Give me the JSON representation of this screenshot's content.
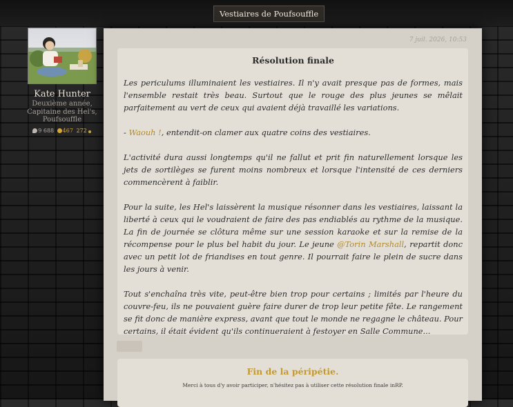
{
  "header": {
    "title": "Vestiaires de Poufsouffle"
  },
  "author": {
    "name": "Kate Hunter",
    "role_lines": [
      "Deuxième année,",
      "Capitaine des Hel's,",
      "Poufsouffle"
    ],
    "stats": {
      "messages": "9 688",
      "coins": "467",
      "points": "272"
    }
  },
  "post": {
    "date": "7 juil. 2026, 10:53",
    "title": "Résolution finale",
    "p1": "Les periculums illuminaient les vestiaires. Il n'y avait presque pas de formes, mais l'ensemble restait très beau. Surtout que le rouge des plus jeunes se mêlait parfaitement au vert de ceux qui avaient déjà travaillé les variations.",
    "p2_dash": "- ",
    "p2_quote": "Waouh !",
    "p2_rest": ", entendit-on clamer aux quatre coins des vestiaires.",
    "p3": "L'activité dura aussi longtemps qu'il ne fallut et prit fin naturellement lorsque les jets de sortilèges se furent moins nombreux et lorsque l'intensité de ces derniers commencèrent à faiblir.",
    "p4_before": "Pour la suite, les Hel's laissèrent la musique résonner dans les vestiaires, laissant la liberté à ceux qui le voudraient de faire des pas endiablés au rythme de la musique. La fin de journée se clôtura même sur une session karaoke et sur la remise de la récompense pour le plus bel habit du jour. Le jeune ",
    "p4_mention": "@Torin Marshall",
    "p4_after": ", repartit donc avec un petit lot de friandises en tout genre. Il pourrait faire le plein de sucre dans les jours à venir.",
    "p5": "Tout s'enchaîna très vite, peut-être bien trop pour certains ; limités par l'heure du couvre-feu, ils ne pouvaient guère faire durer de trop leur petite fête. Le rangement se fit donc de manière express, avant que tout le monde ne regagne le château. Pour certains, il était évident qu'ils continueraient à festoyer en Salle Commune..."
  },
  "footer_card": {
    "title": "Fin de la péripétie.",
    "text": "Merci à tous d'y avoir participer, n'hésitez pas à utiliser cette résolution finale inRP."
  },
  "colors": {
    "accent_gold": "#c49a2e",
    "mention_gold": "#b08a2a"
  },
  "icons": [
    "speech-bubble-icon",
    "coin-icon",
    "star-icon"
  ]
}
